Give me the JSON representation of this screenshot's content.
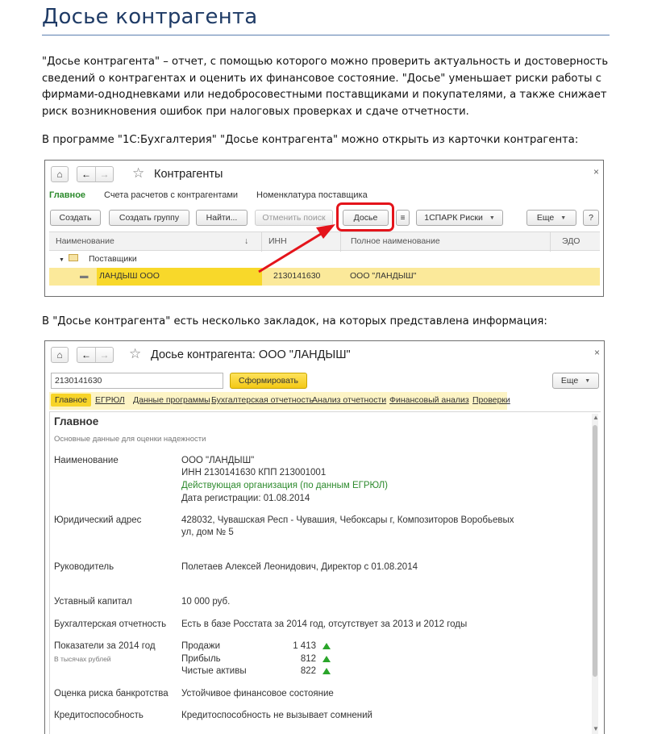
{
  "document": {
    "title": "Досье контрагента",
    "intro_paragraph": "\"Досье контрагента\" – отчет, с помощью которого  можно проверить актуальность и достоверность сведений о контрагентах и оценить их финансовое состояние. \"Досье\" уменьшает риски работы с фирмами-однодневками или недобросовестными поставщиками и покупателями, а также снижает риск возникновения ошибок при налоговых проверках и сдаче отчетности.",
    "open_paragraph": "В программе \"1С:Бухгалтерия\" \"Досье контрагента\" можно открыть из карточки контрагента:",
    "tabs_paragraph": "В \"Досье контрагента\" есть несколько закладок, на которых представлена информация:"
  },
  "window1": {
    "title": "Контрагенты",
    "sections": [
      "Главное",
      "Счета расчетов с контрагентами",
      "Номенклатура поставщика"
    ],
    "buttons": {
      "create": "Создать",
      "create_group": "Создать группу",
      "find": "Найти...",
      "cancel_search": "Отменить поиск",
      "dossier": "Досье",
      "spark": "1СПАРК Риски",
      "more": "Еще",
      "help": "?"
    },
    "columns": [
      "Наименование",
      "ИНН",
      "Полное наименование",
      "ЭДО"
    ],
    "group_row": "Поставщики",
    "selected_row": {
      "name": "ЛАНДЫШ ООО",
      "inn": "2130141630",
      "full_name": "ООО \"ЛАНДЫШ\""
    }
  },
  "window2": {
    "title": "Досье контрагента: ООО \"ЛАНДЫШ\"",
    "search_value": "2130141630",
    "form_button": "Сформировать",
    "more_button": "Еще",
    "tabs": [
      "Главное",
      "ЕГРЮЛ",
      "Данные программы",
      "Бухгалтерская отчетность",
      "Анализ отчетности",
      "Финансовый анализ",
      "Проверки"
    ],
    "panel": {
      "title": "Главное",
      "subtitle": "Основные данные для оценки надежности",
      "rows": {
        "name_label": "Наименование",
        "name_value": "ООО \"ЛАНДЫШ\"",
        "inn_kpp": "ИНН 2130141630 КПП 213001001",
        "status": "Действующая организация (по данным ЕГРЮЛ)",
        "registration": "Дата регистрации: 01.08.2014",
        "address_label": "Юридический адрес",
        "address_line1": "428032, Чувашская Респ - Чувашия, Чебоксары г, Композиторов Воробьевых",
        "address_line2": "ул, дом № 5",
        "manager_label": "Руководитель",
        "manager_value": "Полетаев Алексей Леонидович, Директор с 01.08.2014",
        "capital_label": "Уставный капитал",
        "capital_value": "10 000 руб.",
        "reports_label": "Бухгалтерская отчетность",
        "reports_value": "Есть в базе Росстата за 2014 год, отсутствует за 2013 и 2012 годы",
        "indicators_label": "Показатели за 2014 год",
        "indicators_note": "В тысячах рублей",
        "indicators": [
          {
            "name": "Продажи",
            "value": "1 413",
            "trend": "up"
          },
          {
            "name": "Прибыль",
            "value": "812",
            "trend": "up"
          },
          {
            "name": "Чистые активы",
            "value": "822",
            "trend": "up"
          }
        ],
        "bankruptcy_label": "Оценка риска банкротства",
        "bankruptcy_value": "Устойчивое финансовое состояние",
        "credit_label": "Кредитоспособность",
        "credit_value": "Кредитоспособность не вызывает сомнений"
      }
    }
  },
  "colors": {
    "title_blue": "#1f3b66",
    "active_green": "#2b8a2b",
    "highlight_red": "#e4141b",
    "selection_yellow": "#f8d82a",
    "trend_green": "#2aa52a"
  }
}
